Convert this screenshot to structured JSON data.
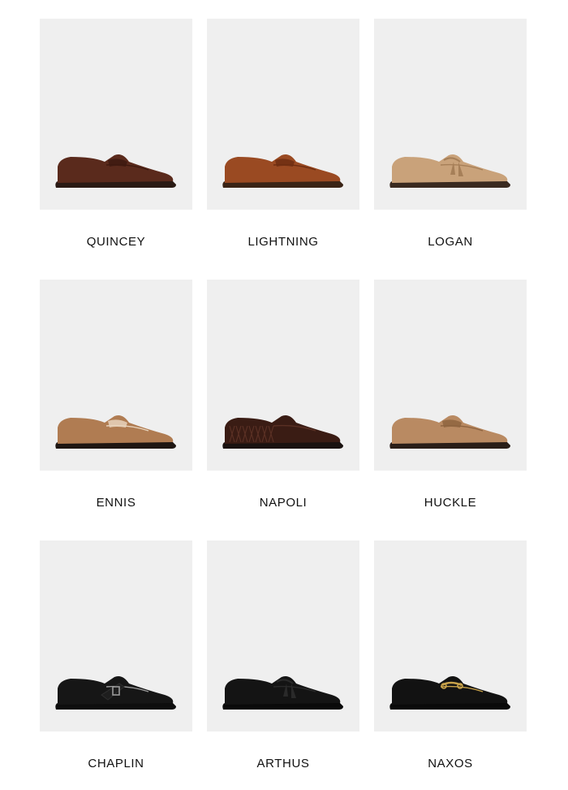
{
  "products": [
    {
      "name": "QUINCEY",
      "shoe": "penny-loafer-icon",
      "upper": "#5a2a1c",
      "accent": "#3e1a10",
      "sole": "#2a1a14"
    },
    {
      "name": "LIGHTNING",
      "shoe": "penny-loafer-icon",
      "upper": "#9a4a22",
      "accent": "#6e2e12",
      "sole": "#3a2416"
    },
    {
      "name": "LOGAN",
      "shoe": "tassel-loafer-icon",
      "upper": "#c9a27a",
      "accent": "#a67f58",
      "sole": "#3a2a20"
    },
    {
      "name": "ENNIS",
      "shoe": "penny-loafer-icon",
      "upper": "#b07c52",
      "accent": "#e8d4bd",
      "sole": "#1e1612"
    },
    {
      "name": "NAPOLI",
      "shoe": "woven-loafer-icon",
      "upper": "#3a1c14",
      "accent": "#5a3024",
      "sole": "#1a1210"
    },
    {
      "name": "HUCKLE",
      "shoe": "penny-loafer-icon",
      "upper": "#b98a62",
      "accent": "#8e6440",
      "sole": "#2a1e18"
    },
    {
      "name": "CHAPLIN",
      "shoe": "monk-strap-icon",
      "upper": "#161616",
      "accent": "#9a9a9a",
      "sole": "#0e0e0e"
    },
    {
      "name": "ARTHUS",
      "shoe": "tassel-loafer-icon",
      "upper": "#141414",
      "accent": "#2a2a2a",
      "sole": "#0a0a0a"
    },
    {
      "name": "NAXOS",
      "shoe": "bit-loafer-icon",
      "upper": "#121212",
      "accent": "#c8a24a",
      "sole": "#0a0a0a"
    }
  ]
}
